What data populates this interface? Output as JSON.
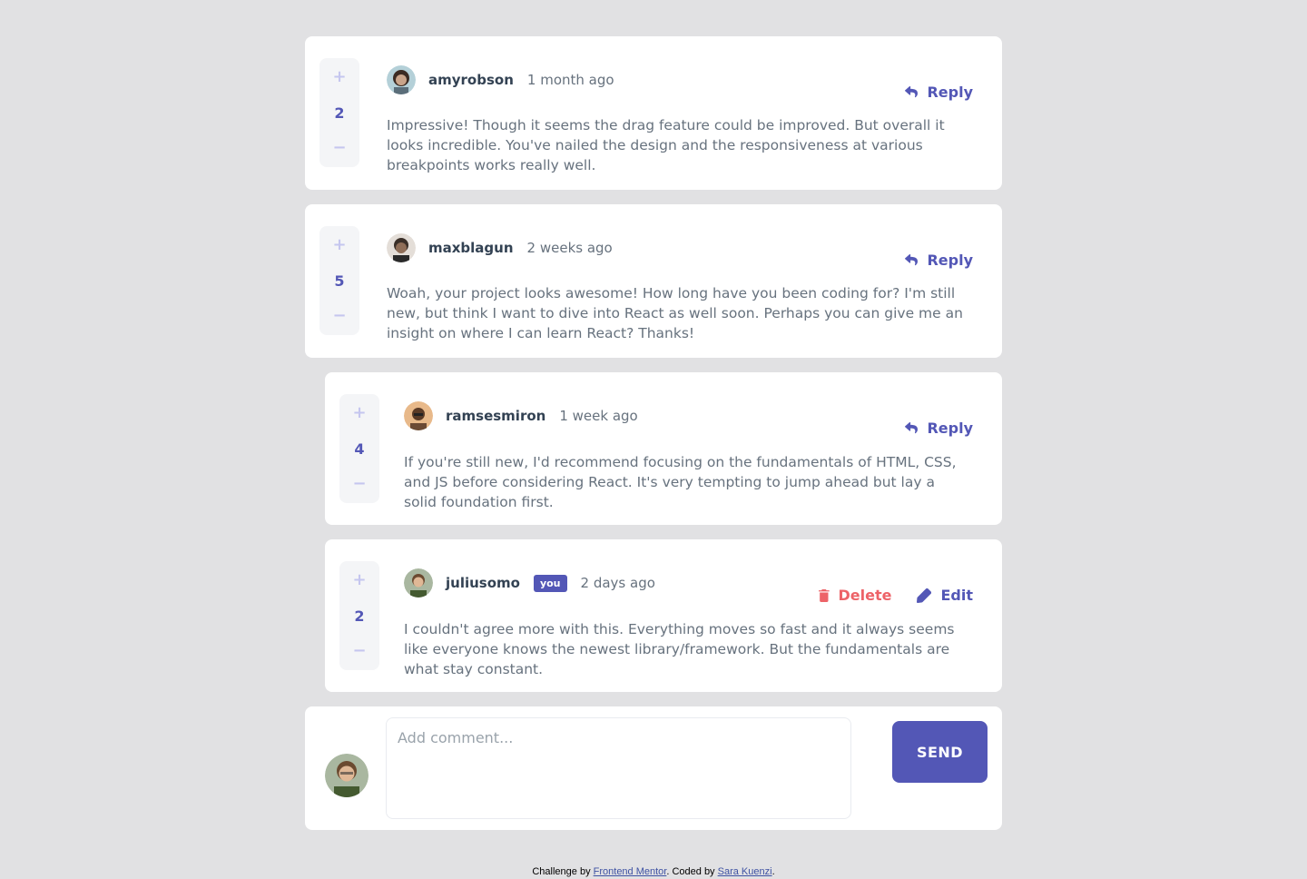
{
  "comments": [
    {
      "username": "amyrobson",
      "time": "1 month ago",
      "score": "2",
      "content": "Impressive! Though it seems the drag feature could be improved. But overall it looks incredible. You've nailed the design and the responsiveness at various breakpoints works really well.",
      "reply_label": "Reply",
      "avatar_color": "#c9a48a"
    },
    {
      "username": "maxblagun",
      "time": "2 weeks ago",
      "score": "5",
      "content": "Woah, your project looks awesome! How long have you been coding for? I'm still new, but think I want to dive into React as well soon. Perhaps you can give me an insight on where I can learn React? Thanks!",
      "reply_label": "Reply",
      "avatar_color": "#5a4a3f"
    }
  ],
  "replies": [
    {
      "username": "ramsesmiron",
      "time": "1 week ago",
      "score": "4",
      "content": "If you're still new, I'd recommend focusing on the fundamentals of HTML, CSS, and JS before considering React. It's very tempting to jump ahead but lay a solid foundation first.",
      "reply_label": "Reply",
      "avatar_color": "#d49a63"
    },
    {
      "username": "juliusomo",
      "badge": "you",
      "time": "2 days ago",
      "score": "2",
      "content": "I couldn't agree more with this. Everything moves so fast and it always seems like everyone knows the newest library/framework. But the fundamentals are what stay constant.",
      "delete_label": "Delete",
      "edit_label": "Edit",
      "avatar_color": "#7b8a5a"
    }
  ],
  "vote": {
    "plus": "+",
    "minus": "−"
  },
  "composer": {
    "placeholder": "Add comment...",
    "send_label": "SEND"
  },
  "footer": {
    "prefix": "Challenge by ",
    "link1": "Frontend Mentor",
    "middle": ". Coded by ",
    "link2": "Sara Kuenzi",
    "suffix": "."
  },
  "colors": {
    "primary": "#5357b6",
    "danger": "#ed6368",
    "background": "#e1e1e3",
    "heading": "#334253",
    "text": "#67727e"
  }
}
